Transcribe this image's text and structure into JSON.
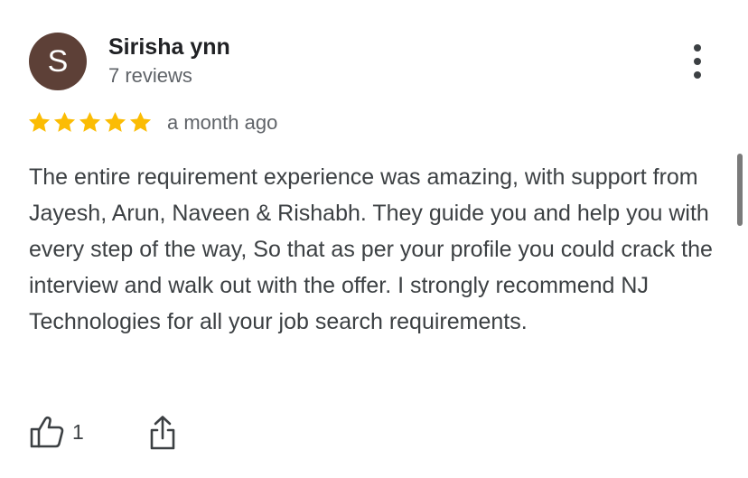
{
  "reviewer": {
    "initial": "S",
    "name": "Sirisha ynn",
    "review_count": "7 reviews",
    "avatar_color": "#5d4037"
  },
  "rating": {
    "stars": 5,
    "max_stars": 5,
    "star_color": "#fbbc04",
    "date": "a month ago"
  },
  "review": {
    "text": "The entire requirement experience was amazing, with support from Jayesh, Arun, Naveen & Rishabh. They guide you and help you with every step of the way, So that as per your profile you could crack the interview and walk out with the offer. I strongly recommend NJ Technologies for all your job search requirements."
  },
  "actions": {
    "like_icon": "thumbs-up-icon",
    "like_count": "1",
    "share_icon": "share-icon",
    "more_icon": "more-vert-icon"
  }
}
